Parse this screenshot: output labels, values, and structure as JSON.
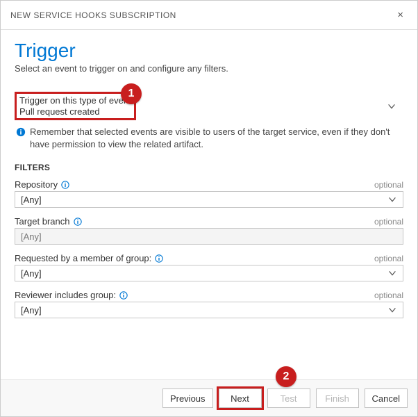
{
  "dialog": {
    "title": "NEW SERVICE HOOKS SUBSCRIPTION",
    "close_glyph": "×"
  },
  "page": {
    "heading": "Trigger",
    "subtitle": "Select an event to trigger on and configure any filters."
  },
  "trigger": {
    "label": "Trigger on this type of event",
    "value": "Pull request created"
  },
  "info": {
    "text": "Remember that selected events are visible to users of the target service, even if they don't have permission to view the related artifact."
  },
  "filters": {
    "heading": "FILTERS",
    "optional_label": "optional",
    "items": [
      {
        "label": "Repository",
        "value": "[Any]",
        "has_help": true,
        "editable": true
      },
      {
        "label": "Target branch",
        "value": "[Any]",
        "has_help": true,
        "editable": false
      },
      {
        "label": "Requested by a member of group:",
        "value": "[Any]",
        "has_help": true,
        "editable": true
      },
      {
        "label": "Reviewer includes group:",
        "value": "[Any]",
        "has_help": true,
        "editable": true
      }
    ]
  },
  "footer": {
    "previous": "Previous",
    "next": "Next",
    "test": "Test",
    "finish": "Finish",
    "cancel": "Cancel"
  },
  "callouts": {
    "one": "1",
    "two": "2"
  }
}
